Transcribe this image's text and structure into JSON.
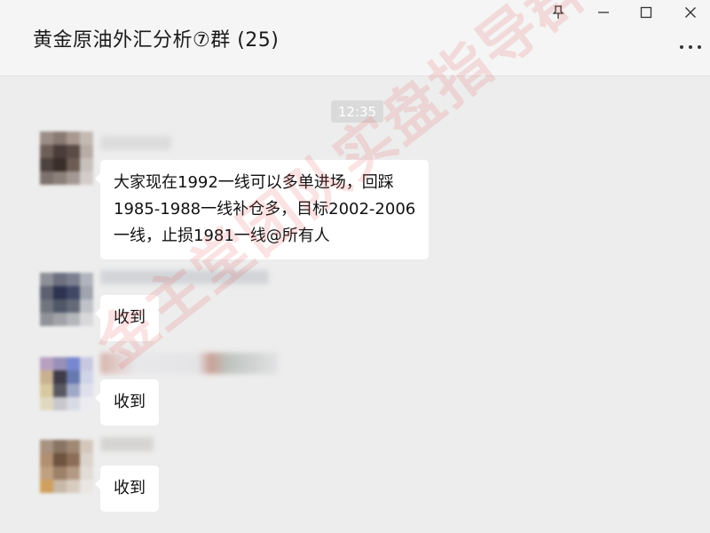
{
  "window": {
    "title": "黄金原油外汇分析⑦群 (25)",
    "controls": [
      "pin-icon",
      "minimize-icon",
      "maximize-icon",
      "close-icon"
    ],
    "more_icon": "more-icon"
  },
  "chat": {
    "timestamp": "12:35",
    "messages": [
      {
        "sender_name_visible": false,
        "lines": [
          "大家现在1992一线可以多单进场，回踩",
          "1985-1988一线补仓多，目标2002-2006",
          "一线，止损1981一线@所有人"
        ]
      },
      {
        "sender_name_visible": false,
        "lines": [
          "收到"
        ]
      },
      {
        "sender_name_visible": false,
        "lines": [
          "收到"
        ]
      },
      {
        "sender_name_visible": false,
        "lines": [
          "收到"
        ]
      }
    ]
  },
  "watermark": {
    "text": "金主堂团队实盘指导群"
  },
  "colors": {
    "background": "#ededed",
    "header": "#f5f5f5",
    "bubble": "#ffffff",
    "timestamp_badge": "#dadada",
    "watermark": "#e65050"
  }
}
